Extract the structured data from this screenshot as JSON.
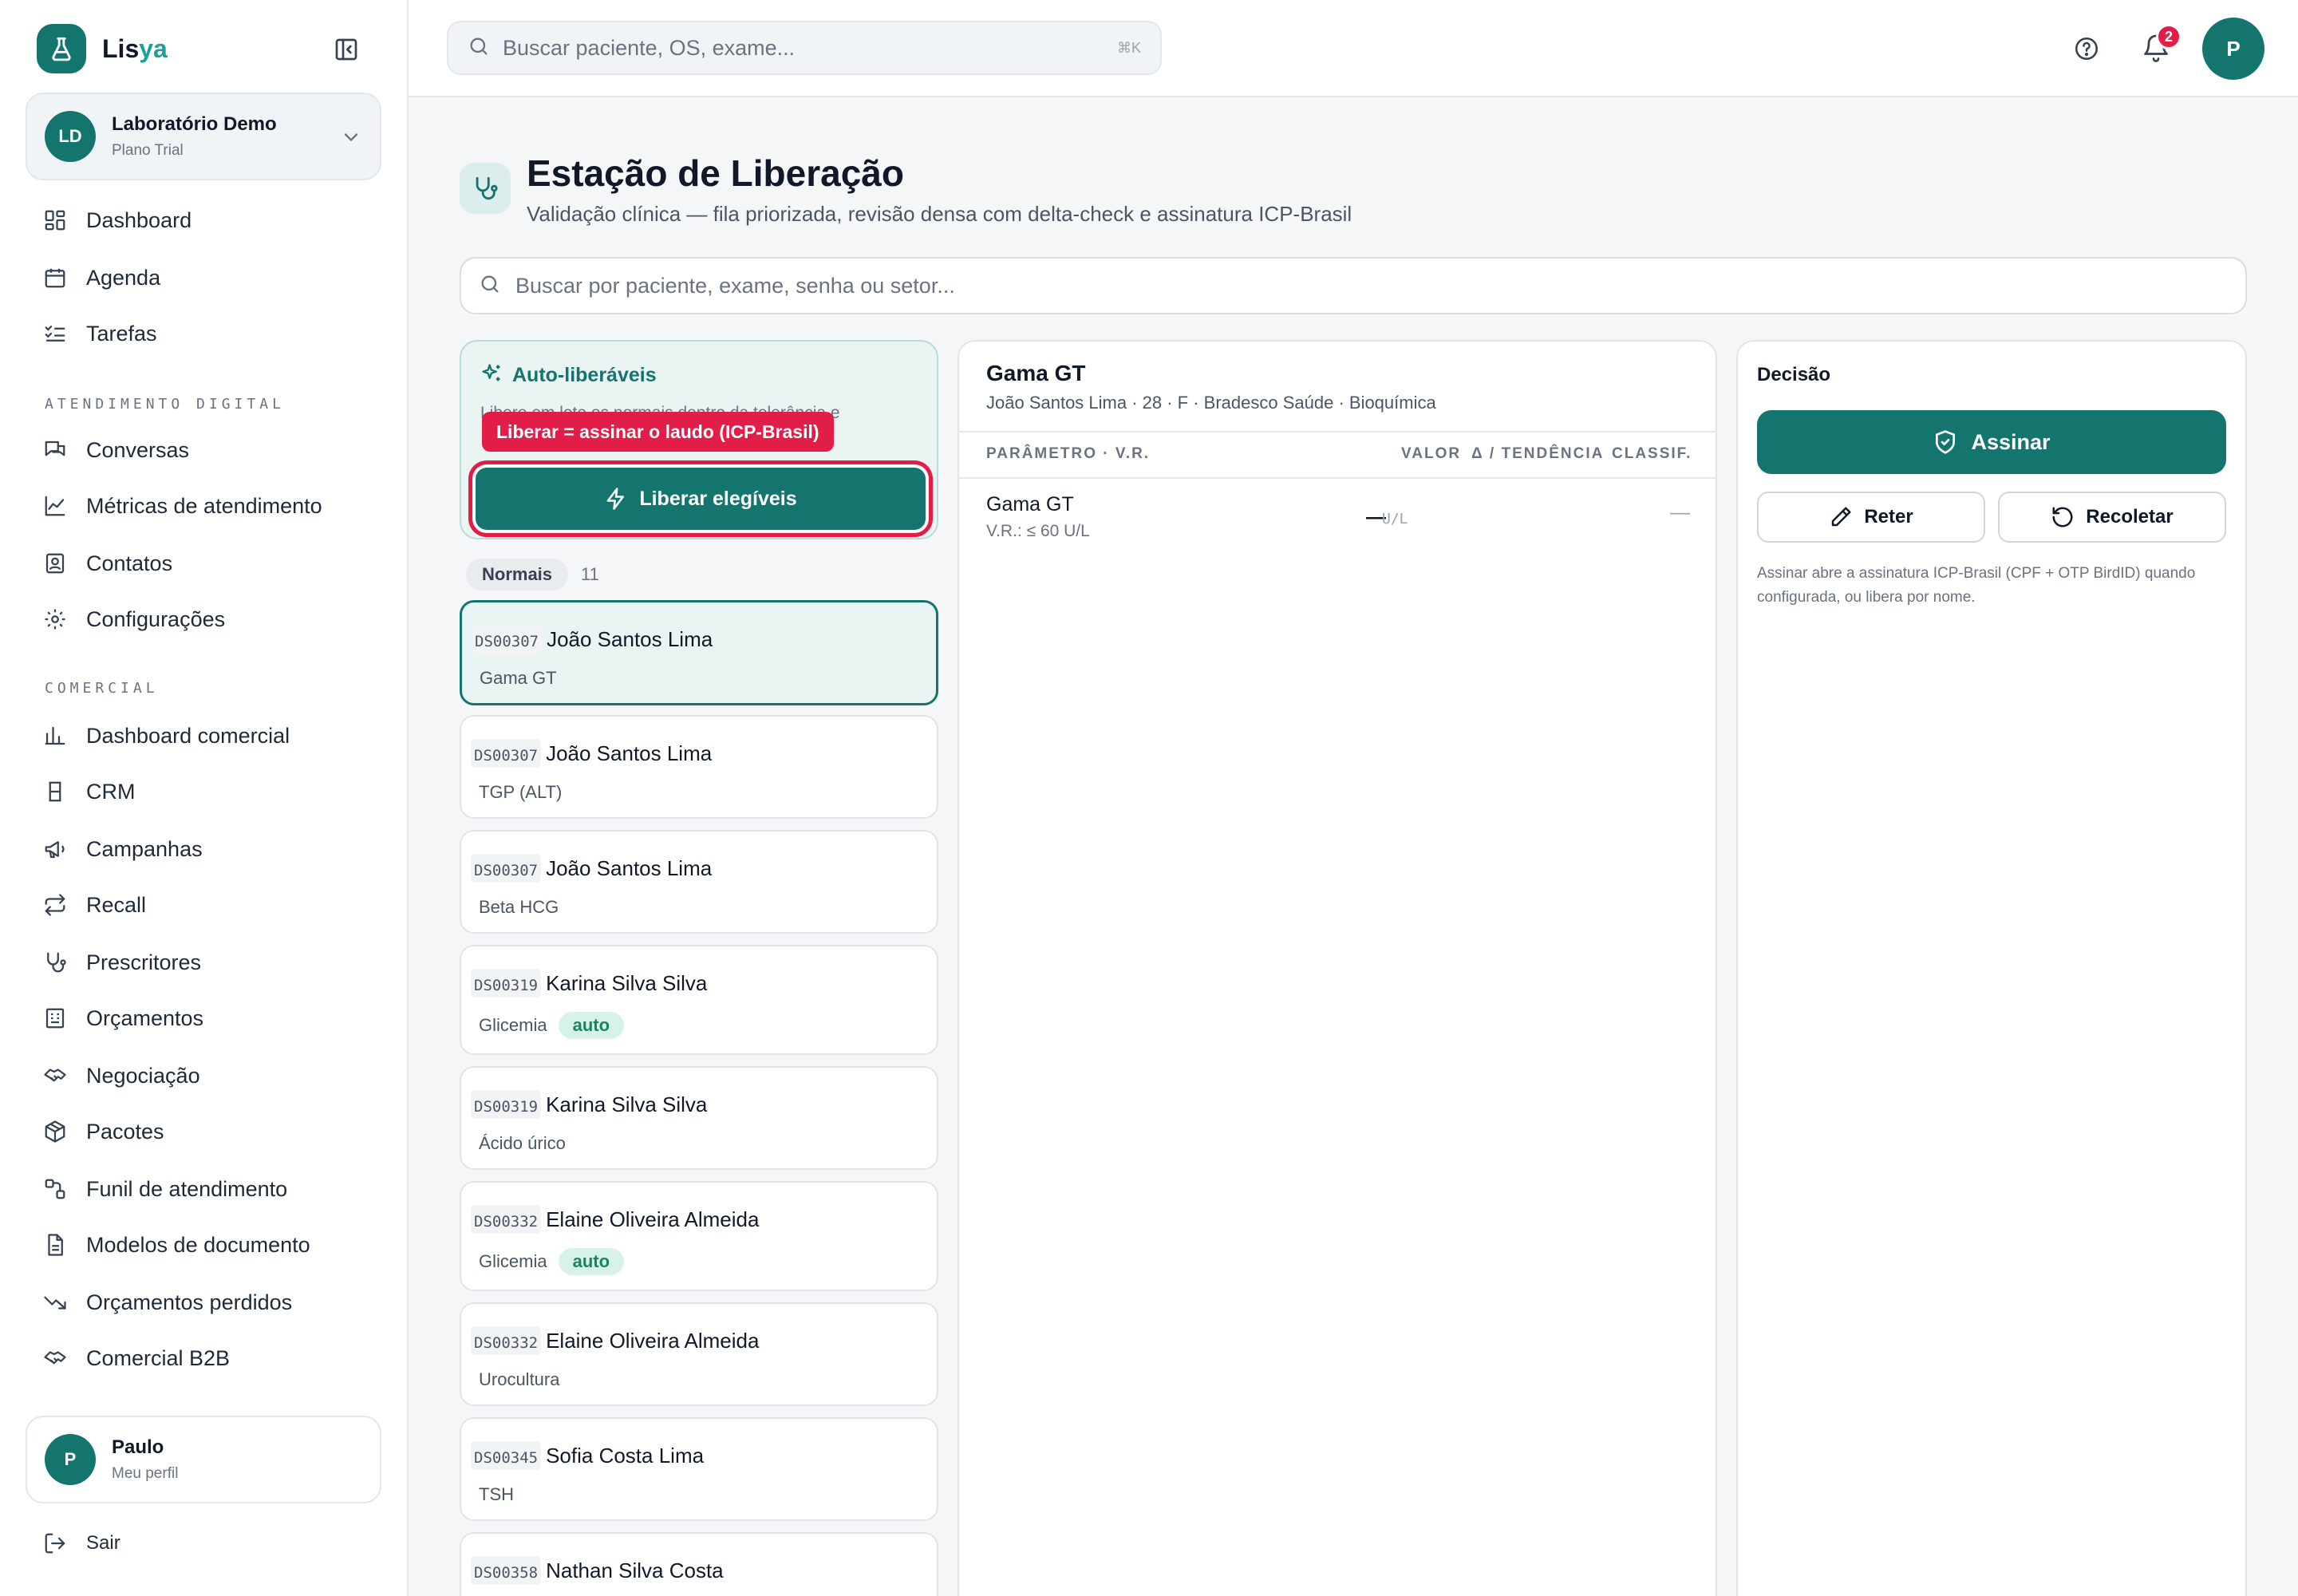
{
  "brand": {
    "name_part1": "Lis",
    "name_part2": "ya",
    "color": "#14756f"
  },
  "org": {
    "initials": "LD",
    "name": "Laboratório Demo",
    "plan": "Plano Trial"
  },
  "nav": {
    "main": [
      "Dashboard",
      "Agenda",
      "Tarefas"
    ],
    "section_digital": "ATENDIMENTO DIGITAL",
    "digital": [
      "Conversas",
      "Métricas de atendimento",
      "Contatos",
      "Configurações"
    ],
    "section_comercial": "COMERCIAL",
    "comercial": [
      "Dashboard comercial",
      "CRM",
      "Campanhas",
      "Recall",
      "Prescritores",
      "Orçamentos",
      "Negociação",
      "Pacotes",
      "Funil de atendimento",
      "Modelos de documento",
      "Orçamentos perdidos",
      "Comercial B2B"
    ]
  },
  "profile": {
    "initial": "P",
    "name": "Paulo",
    "sub": "Meu perfil"
  },
  "logout_label": "Sair",
  "topbar": {
    "search_placeholder": "Buscar paciente, OS, exame...",
    "search_shortcut": "⌘K",
    "notification_count": "2",
    "user_initial": "P"
  },
  "page": {
    "title": "Estação de Liberação",
    "subtitle": "Validação clínica — fila priorizada, revisão densa com delta-check e assinatura ICP-Brasil",
    "search_placeholder": "Buscar por paciente, exame, senha ou setor..."
  },
  "auto_release": {
    "title": "Auto-liberáveis",
    "description": "Libere em lote os normais dentro da tolerância e",
    "tooltip": "Liberar = assinar o laudo (ICP-Brasil)",
    "button": "Liberar elegíveis"
  },
  "queue": {
    "group_label": "Normais",
    "group_count": "11",
    "items": [
      {
        "code": "DS00307",
        "name": "João Santos Lima",
        "exam": "Gama GT",
        "auto": ""
      },
      {
        "code": "DS00307",
        "name": "João Santos Lima",
        "exam": "TGP (ALT)",
        "auto": ""
      },
      {
        "code": "DS00307",
        "name": "João Santos Lima",
        "exam": "Beta HCG",
        "auto": ""
      },
      {
        "code": "DS00319",
        "name": "Karina Silva Silva",
        "exam": "Glicemia",
        "auto": "auto"
      },
      {
        "code": "DS00319",
        "name": "Karina Silva Silva",
        "exam": "Ácido úrico",
        "auto": ""
      },
      {
        "code": "DS00332",
        "name": "Elaine Oliveira Almeida",
        "exam": "Glicemia",
        "auto": "auto"
      },
      {
        "code": "DS00332",
        "name": "Elaine Oliveira Almeida",
        "exam": "Urocultura",
        "auto": ""
      },
      {
        "code": "DS00345",
        "name": "Sofia Costa Lima",
        "exam": "TSH",
        "auto": ""
      },
      {
        "code": "DS00358",
        "name": "Nathan Silva Costa",
        "exam": "",
        "auto": ""
      }
    ]
  },
  "review": {
    "exam": "Gama GT",
    "patient_info": "João Santos Lima · 28 · F · Bradesco Saúde · Bioquímica",
    "headers": {
      "param": "PARÂMETRO · V.R.",
      "value": "VALOR",
      "trend": "Δ / TENDÊNCIA",
      "class": "CLASSIF."
    },
    "row": {
      "param": "Gama GT",
      "ref": "V.R.: ≤ 60 U/L",
      "value": "—",
      "unit": "U/L",
      "class": "—"
    }
  },
  "decision": {
    "title": "Decisão",
    "sign": "Assinar",
    "hold": "Reter",
    "recollect": "Recoletar",
    "note": "Assinar abre a assinatura ICP-Brasil (CPF + OTP BirdID) quando configurada, ou libera por nome."
  }
}
